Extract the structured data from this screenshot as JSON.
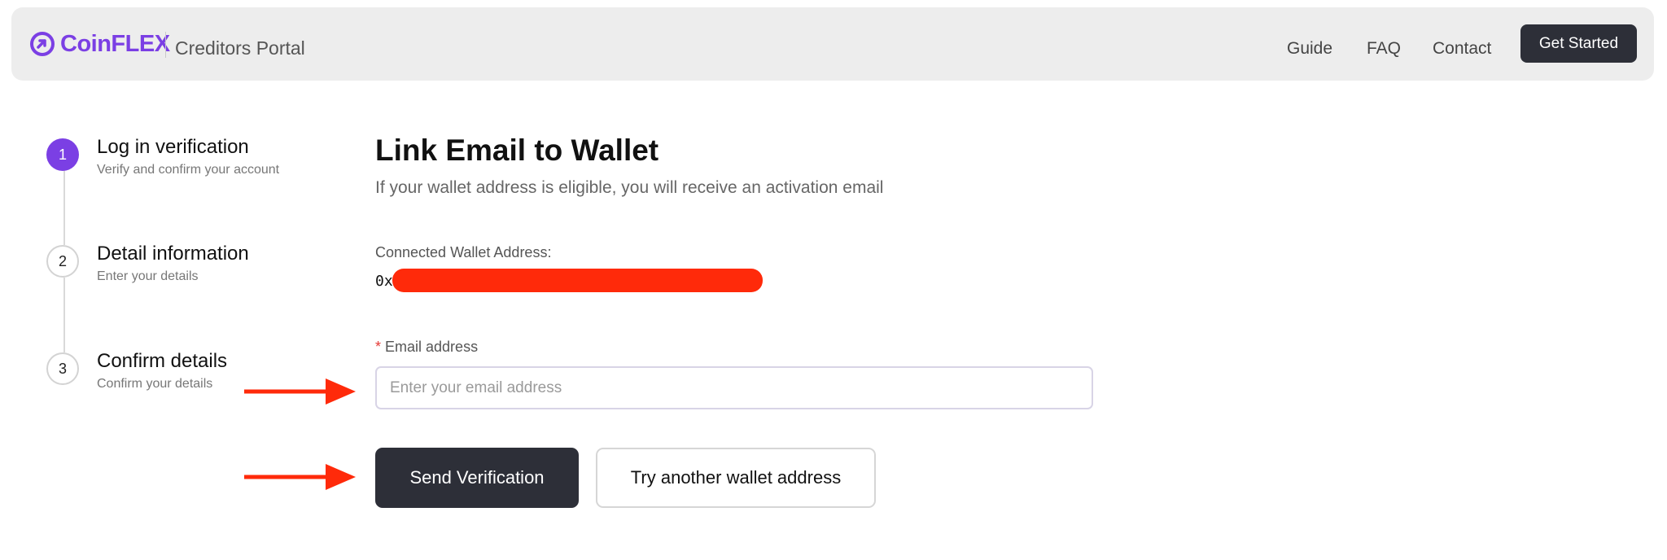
{
  "header": {
    "logo_text": "CoinFLEX",
    "portal_title": "Creditors Portal",
    "nav": [
      "Guide",
      "FAQ",
      "Contact"
    ],
    "cta_label": "Get Started"
  },
  "steps": [
    {
      "number": "1",
      "title": "Log in verification",
      "subtitle": "Verify and confirm your account",
      "state": "active"
    },
    {
      "number": "2",
      "title": "Detail information",
      "subtitle": "Enter your details",
      "state": "inactive"
    },
    {
      "number": "3",
      "title": "Confirm details",
      "subtitle": "Confirm your details",
      "state": "inactive"
    }
  ],
  "main": {
    "title": "Link Email to Wallet",
    "subtitle": "If your wallet address is eligible, you will receive an activation email",
    "wallet_label": "Connected Wallet Address:",
    "wallet_value": "0x",
    "email_required_mark": "*",
    "email_label": "Email address",
    "email_value": "",
    "email_placeholder": "Enter your email address",
    "send_label": "Send Verification",
    "try_another_label": "Try another wallet address"
  },
  "colors": {
    "accent": "#7b3fe4",
    "dark_button": "#2d2f38",
    "annotation_red": "#ff2a0a"
  }
}
